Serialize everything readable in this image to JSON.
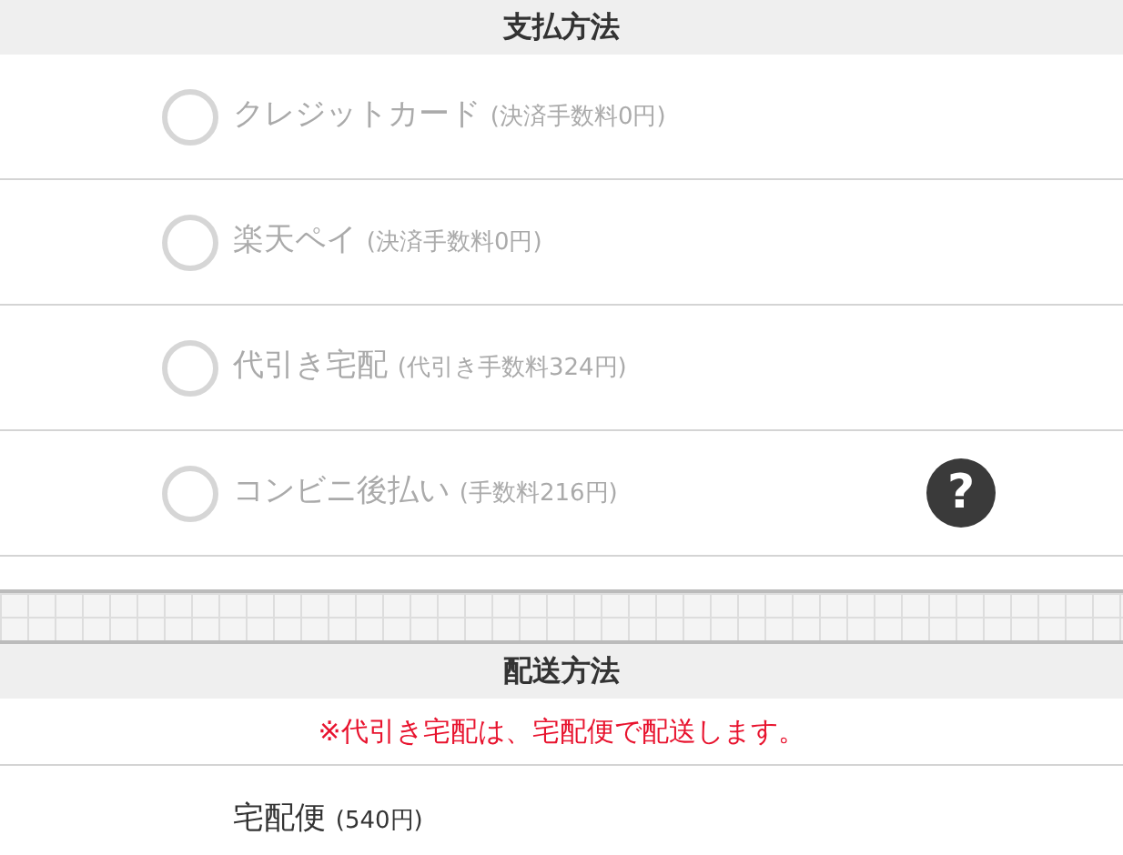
{
  "payment": {
    "title": "支払方法",
    "options": [
      {
        "label": "クレジットカード",
        "fee": "(決済手数料0円)",
        "selected": false,
        "disabled": true
      },
      {
        "label": "楽天ペイ",
        "fee": "(決済手数料0円)",
        "selected": false,
        "disabled": true
      },
      {
        "label": "代引き宅配",
        "fee": "(代引き手数料324円)",
        "selected": false,
        "disabled": true
      },
      {
        "label": "コンビニ後払い",
        "fee": "(手数料216円)",
        "selected": false,
        "disabled": true,
        "help": "?"
      }
    ]
  },
  "shipping": {
    "title": "配送方法",
    "notice": "※代引き宅配は、宅配便で配送します。",
    "options": [
      {
        "label": "宅配便",
        "fee": "(540円)"
      }
    ]
  }
}
